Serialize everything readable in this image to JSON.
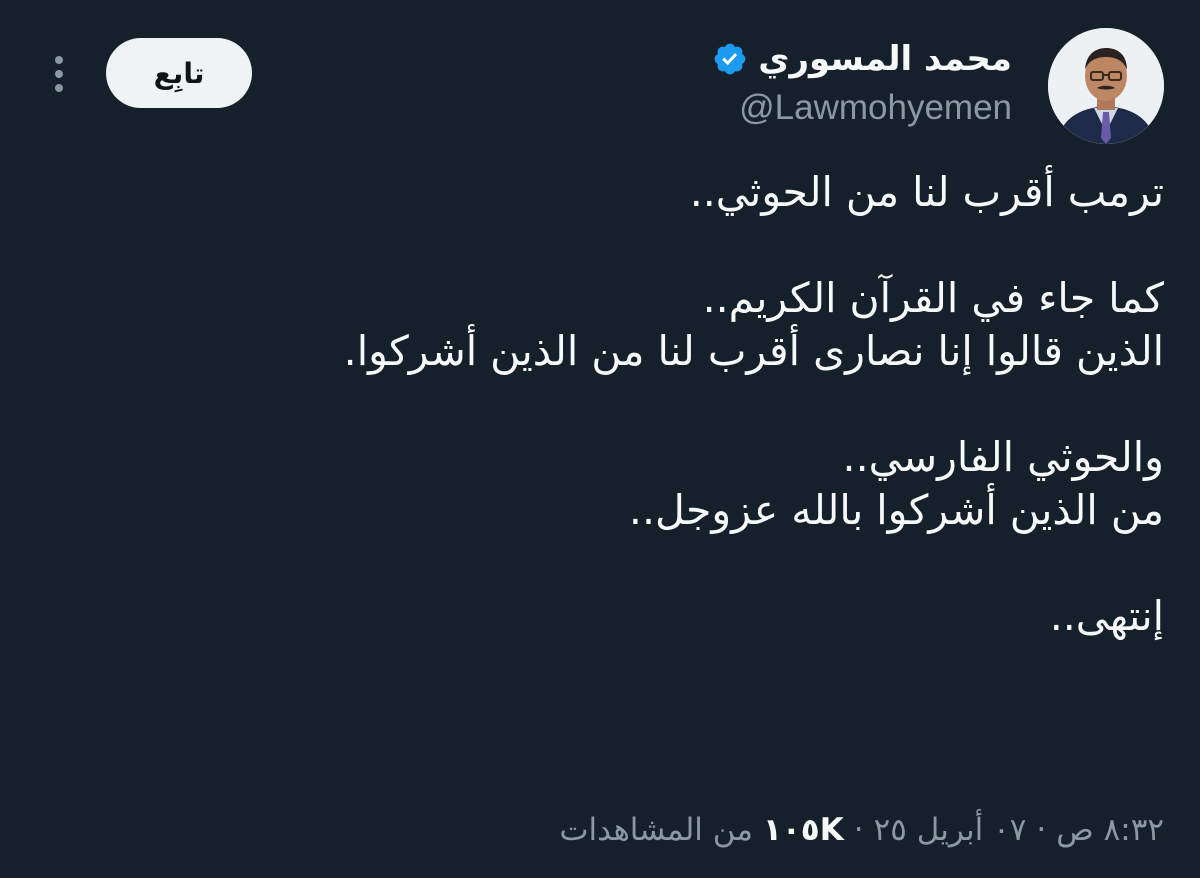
{
  "author": {
    "display_name": "محمد المسوري",
    "handle": "@Lawmohyemen",
    "verified": true
  },
  "follow_button": {
    "label": "تابِع"
  },
  "tweet": {
    "lines": [
      "ترمب أقرب لنا من الحوثي..",
      "",
      "كما جاء في القرآن الكريم..",
      "الذين قالوا إنا نصارى أقرب لنا من الذين أشركوا.",
      "",
      "والحوثي الفارسي..",
      "من الذين أشركوا بالله عزوجل..",
      "",
      "إنتهى.."
    ]
  },
  "meta": {
    "time": "٨:٣٢ ص",
    "date": "٠٧ أبريل ٢٥",
    "separator": "·",
    "views_count": "١٠٥K",
    "views_label": "من المشاهدات"
  },
  "colors": {
    "background": "#15202b",
    "text_primary": "#f7f9f9",
    "text_secondary": "#8b98a5",
    "verified_badge": "#1d9bf0",
    "follow_button_bg": "#eff3f4"
  },
  "icons": {
    "verified": "verified-badge-icon",
    "more": "more-vertical-icon"
  }
}
